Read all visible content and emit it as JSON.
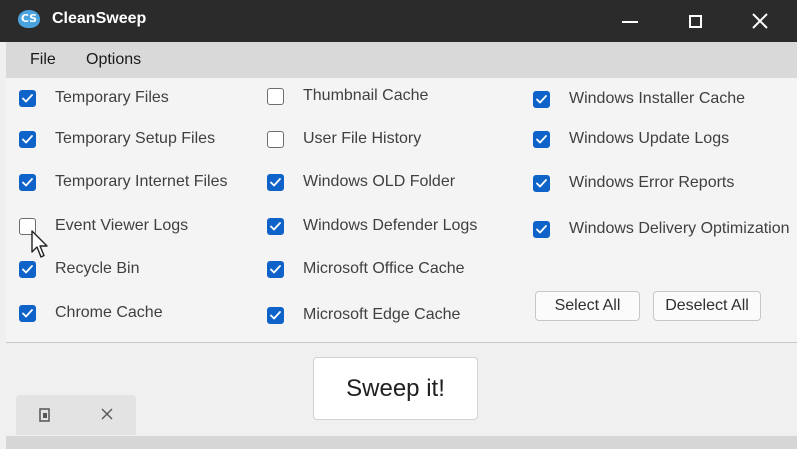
{
  "window": {
    "title": "CleanSweep",
    "logo_text": "CS",
    "accent_color": "#0f63c8",
    "titlebar_color": "#2b2b2b"
  },
  "menu": {
    "file": "File",
    "options": "Options"
  },
  "checkboxes": {
    "temporary_files": {
      "label": "Temporary Files",
      "checked": true
    },
    "temporary_setup_files": {
      "label": "Temporary Setup Files",
      "checked": true
    },
    "temporary_internet_files": {
      "label": "Temporary Internet Files",
      "checked": true
    },
    "event_viewer_logs": {
      "label": "Event Viewer Logs",
      "checked": false
    },
    "recycle_bin": {
      "label": "Recycle Bin",
      "checked": true
    },
    "chrome_cache": {
      "label": "Chrome Cache",
      "checked": true
    },
    "thumbnail_cache": {
      "label": "Thumbnail Cache",
      "checked": false
    },
    "user_file_history": {
      "label": "User File History",
      "checked": false
    },
    "windows_old_folder": {
      "label": "Windows OLD Folder",
      "checked": true
    },
    "windows_defender_logs": {
      "label": "Windows Defender Logs",
      "checked": true
    },
    "microsoft_office_cache": {
      "label": "Microsoft Office Cache",
      "checked": true
    },
    "microsoft_edge_cache": {
      "label": "Microsoft Edge Cache",
      "checked": true
    },
    "windows_installer_cache": {
      "label": "Windows Installer Cache",
      "checked": true
    },
    "windows_update_logs": {
      "label": "Windows Update Logs",
      "checked": true
    },
    "windows_error_reports": {
      "label": "Windows Error Reports",
      "checked": true
    },
    "windows_delivery_optimization": {
      "label": "Windows Delivery Optimization",
      "checked": true
    }
  },
  "buttons": {
    "select_all": "Select All",
    "deselect_all": "Deselect All",
    "sweep": "Sweep it!"
  },
  "icons": {
    "minimize": "minimize-icon",
    "maximize": "maximize-icon",
    "close": "close-icon",
    "tab_document": "document-icon",
    "tab_close": "close-icon",
    "cursor": "mouse-cursor-icon"
  }
}
